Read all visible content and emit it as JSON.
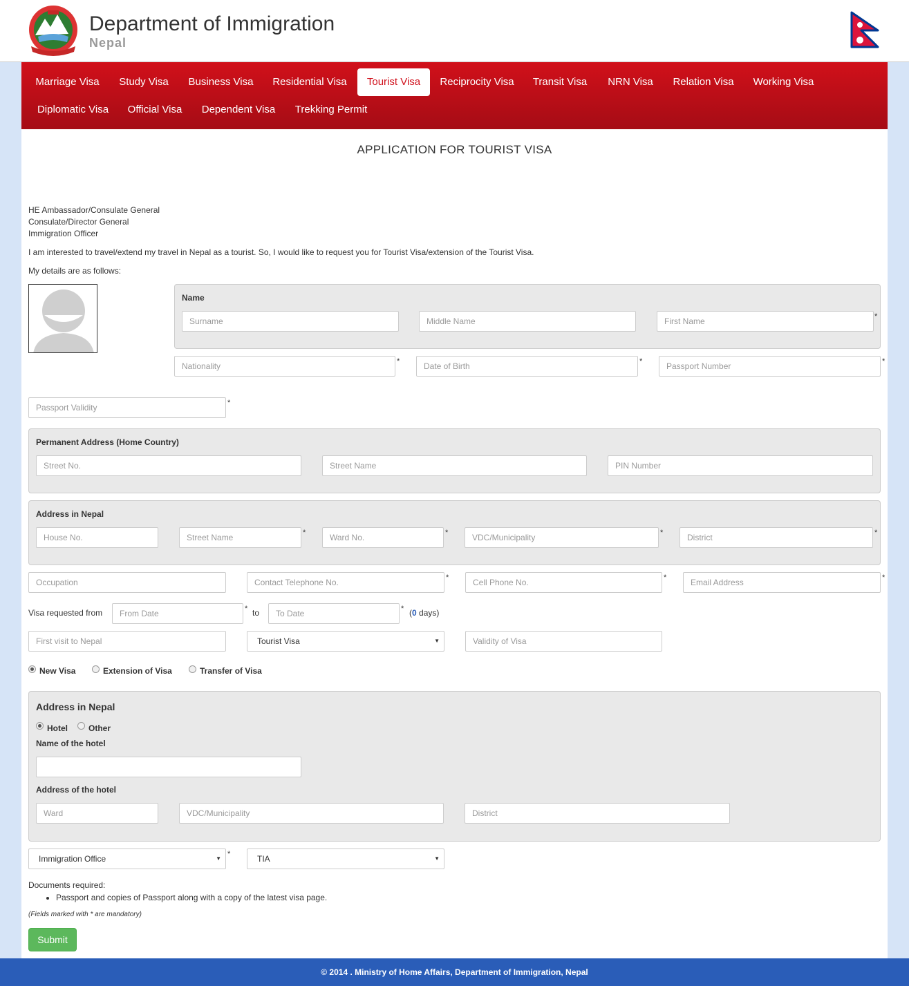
{
  "header": {
    "title": "Department of Immigration",
    "subtitle": "Nepal"
  },
  "nav": {
    "items": [
      "Marriage Visa",
      "Study Visa",
      "Business Visa",
      "Residential Visa",
      "Tourist Visa",
      "Reciprocity Visa",
      "Transit Visa",
      "NRN Visa",
      "Relation Visa",
      "Working Visa",
      "Diplomatic Visa",
      "Official Visa",
      "Dependent Visa",
      "Trekking Permit"
    ],
    "active": "Tourist Visa"
  },
  "form": {
    "title": "APPLICATION FOR TOURIST VISA",
    "address_lines": [
      "HE Ambassador/Consulate General",
      "Consulate/Director General",
      "Immigration Officer"
    ],
    "intro": "I am interested to travel/extend my travel in Nepal as a tourist. So, I would like to request you for Tourist Visa/extension of the Tourist Visa.",
    "details_intro": "My details are as follows:",
    "name_label": "Name",
    "surname": "Surname",
    "middle_name": "Middle Name",
    "first_name": "First Name",
    "nationality": "Nationality",
    "dob": "Date of Birth",
    "passport_number": "Passport Number",
    "passport_validity": "Passport Validity",
    "perm_label": "Permanent Address (Home Country)",
    "perm_street_no": "Street No.",
    "perm_street_name": "Street Name",
    "perm_pin": "PIN Number",
    "nepal_label": "Address in Nepal",
    "house_no": "House No.",
    "np_street_name": "Street Name",
    "ward_no": "Ward No.",
    "vdc": "VDC/Municipality",
    "district": "District",
    "occupation": "Occupation",
    "contact_tel": "Contact Telephone No.",
    "cell": "Cell Phone No.",
    "email": "Email Address",
    "visa_from_label": "Visa requested from",
    "from_date": "From Date",
    "to_label": "to",
    "to_date": "To Date",
    "days_open": "(",
    "days_count": "0",
    "days_close": " days)",
    "first_visit": "First visit to Nepal",
    "visa_type": "Tourist Visa",
    "validity_of_visa": "Validity of Visa",
    "radio_new": "New Visa",
    "radio_ext": "Extension of Visa",
    "radio_transfer": "Transfer of Visa",
    "stay_label": "Address in Nepal",
    "radio_hotel": "Hotel",
    "radio_other": "Other",
    "hotel_name_label": "Name of the hotel",
    "hotel_addr_label": "Address of the hotel",
    "hotel_ward": "Ward",
    "hotel_vdc": "VDC/Municipality",
    "hotel_district": "District",
    "office_select": "Immigration Office",
    "office_value": "TIA",
    "docs_label": "Documents required:",
    "docs_item": "Passport and copies of Passport along with a copy of the latest visa page.",
    "mandatory_note": "(Fields marked with * are mandatory)",
    "submit": "Submit",
    "star": "*"
  },
  "footer": {
    "text": "© 2014 . Ministry of Home Affairs, Department of Immigration, Nepal"
  },
  "colors": {
    "nav_red": "#c70f18",
    "submit_green": "#5cb85c",
    "footer_blue": "#2a5db8",
    "background": "#d6e4f7"
  }
}
